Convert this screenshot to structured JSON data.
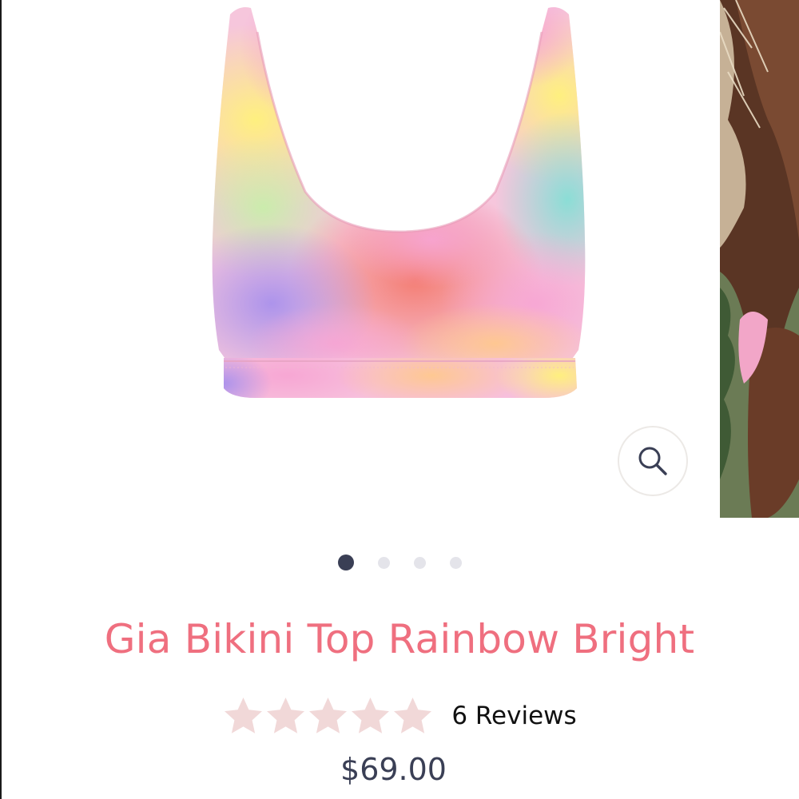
{
  "product": {
    "title": "Gia Bikini Top Rainbow Bright",
    "price": "$69.00",
    "reviews_label": "6 Reviews",
    "rating": 0,
    "max_rating": 5
  },
  "gallery": {
    "slide_count": 4,
    "active_index": 0,
    "zoom_icon": "search-icon"
  },
  "colors": {
    "title": "#ef6f7f",
    "star": "#f1d8d8",
    "dot_active": "#3a3f55",
    "dot_inactive": "#e4e4ea",
    "price": "#3a3f55"
  }
}
